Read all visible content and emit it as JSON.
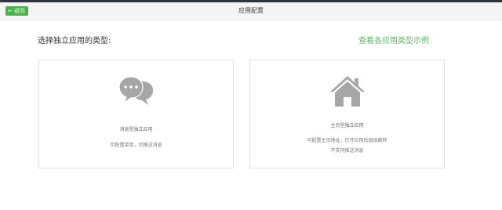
{
  "header": {
    "back_label": "返回",
    "title": "应用配置"
  },
  "main": {
    "prompt": "选择独立应用的类型:",
    "examples_link": "查看各应用类型示例"
  },
  "cards": [
    {
      "icon": "chat-bubbles-icon",
      "name": "消息型独立应用",
      "desc1": "可配置菜单，可推送消息"
    },
    {
      "icon": "home-icon",
      "name": "主页型独立应用",
      "desc1": "可配置主页地址，打开应用后直接跳转",
      "desc2": "不支持推送消息"
    }
  ],
  "colors": {
    "accent": "#5cb85c",
    "button": "#4cae4c",
    "icon": "#a6a6a6"
  }
}
